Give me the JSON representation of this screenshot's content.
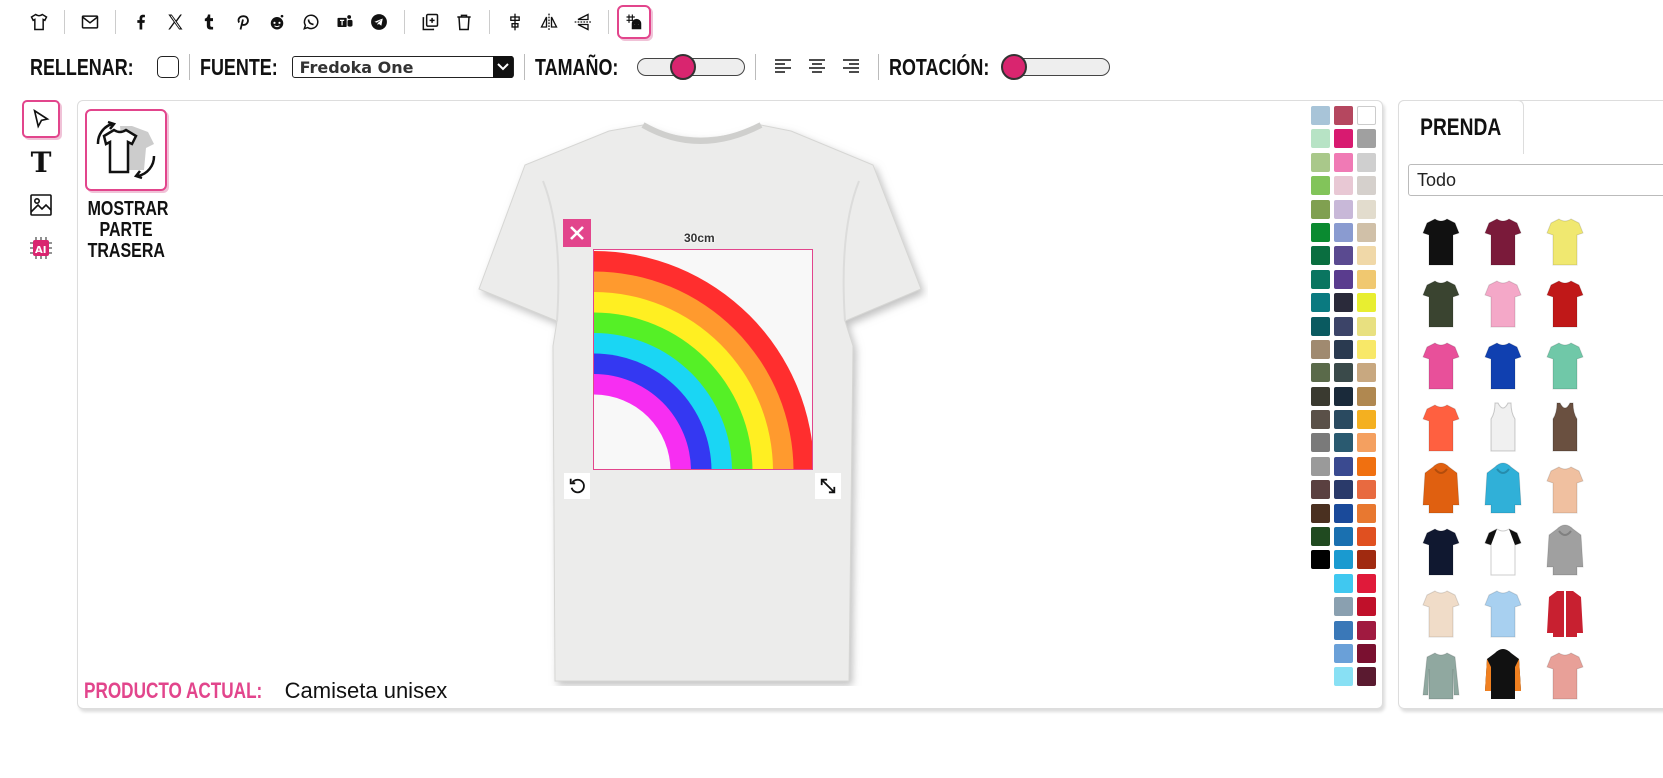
{
  "toolbar": {
    "icons": [
      "tshirt-icon",
      "email-icon",
      "facebook-icon",
      "x-icon",
      "tumblr-icon",
      "pinterest-icon",
      "reddit-icon",
      "whatsapp-icon",
      "teams-icon",
      "telegram-icon",
      "duplicate-icon",
      "delete-icon",
      "align-center-icon",
      "flip-horizontal-icon",
      "flip-vertical-icon",
      "grid-snap-icon"
    ]
  },
  "options": {
    "fill_label": "RELLENAR:",
    "font_label": "FUENTE:",
    "font_value": "Fredoka One",
    "size_label": "TAMAÑO:",
    "size_value": 0.38,
    "rotation_label": "ROTACIÓN:",
    "rotation_value": 0.0
  },
  "left_tools": [
    "select-tool-icon",
    "text-tool-icon",
    "image-tool-icon",
    "ai-tool-icon"
  ],
  "canvas": {
    "back_button_label_1": "MOSTRAR",
    "back_button_label_2": "PARTE",
    "back_button_label_3": "TRASERA",
    "dimension": "30cm",
    "product_label": "PRODUCTO ACTUAL:",
    "product_name": "Camiseta unisex",
    "rainbow_colors": [
      "#ff2e2e",
      "#ff9a2e",
      "#ffef22",
      "#55f026",
      "#1ad6f4",
      "#3438f2",
      "#f72ef2"
    ]
  },
  "palette": [
    [
      "#a8c4d8",
      "#b5475f",
      "#ffffff"
    ],
    [
      "#b7e3c5",
      "#d81a70",
      "#a0a0a0"
    ],
    [
      "#a9c88a",
      "#f07ab5",
      "#cfcfcf"
    ],
    [
      "#82c45a",
      "#e8c8d4",
      "#d5d0cc"
    ],
    [
      "#80a050",
      "#c8b8d8",
      "#e2dccd"
    ],
    [
      "#0a8a30",
      "#8a9bd0",
      "#d0c0a8"
    ],
    [
      "#0a6e40",
      "#5a4a90",
      "#f0d8a8"
    ],
    [
      "#0a7560",
      "#5a3c8e",
      "#f0c870"
    ],
    [
      "#0a7a80",
      "#2a2a3a",
      "#e8ee30"
    ],
    [
      "#0a5a60",
      "#3c4468",
      "#e8e080"
    ],
    [
      "#a08a70",
      "#2a3a50",
      "#f8e868"
    ],
    [
      "#5a6a4a",
      "#3a4a4a",
      "#c8a880"
    ],
    [
      "#3a3a30",
      "#1a2a3a",
      "#b08850"
    ],
    [
      "#5a5048",
      "#2a4a60",
      "#f4b020"
    ],
    [
      "#7a7a7a",
      "#2a5a70",
      "#f4a060"
    ],
    [
      "#9a9a9a",
      "#3a4a90",
      "#f07010"
    ],
    [
      "#5a4040",
      "#2a3a6a",
      "#e86a40"
    ],
    [
      "#4a3020",
      "#1a4a9a",
      "#e87830"
    ],
    [
      "#204a20",
      "#1a70b0",
      "#e05020"
    ],
    [
      "#000000",
      "#1a9ad0",
      "#a02a10"
    ],
    [
      null,
      "#40c8f0",
      "#e01a3a"
    ],
    [
      null,
      "#8aa0b0",
      "#c0102a"
    ],
    [
      null,
      "#3a78b8",
      "#a01a40"
    ],
    [
      null,
      "#6aa0d8",
      "#7a1030"
    ],
    [
      null,
      "#88e0f4",
      "#5a1a30"
    ]
  ],
  "panel": {
    "tab_label": "PRENDA",
    "filter_value": "Todo",
    "products": [
      {
        "name": "black-tshirt",
        "color": "#111111",
        "type": "tee"
      },
      {
        "name": "burgundy-tshirt",
        "color": "#7a1a3a",
        "type": "tee"
      },
      {
        "name": "yellow-tshirt",
        "color": "#f0e870",
        "type": "tee"
      },
      {
        "name": "olive-tshirt",
        "color": "#3a4430",
        "type": "tee"
      },
      {
        "name": "pink-tshirt",
        "color": "#f4a8c8",
        "type": "tee"
      },
      {
        "name": "red-tshirt",
        "color": "#c01818",
        "type": "tee"
      },
      {
        "name": "magenta-tshirt",
        "color": "#e8509a",
        "type": "tee"
      },
      {
        "name": "blue-tshirt",
        "color": "#1040b0",
        "type": "tee"
      },
      {
        "name": "mint-tshirt",
        "color": "#70c8a8",
        "type": "tee"
      },
      {
        "name": "coral-tshirt",
        "color": "#ff6040",
        "type": "tee"
      },
      {
        "name": "white-tank",
        "color": "#f0f0f0",
        "type": "tank"
      },
      {
        "name": "brown-tank",
        "color": "#6a5040",
        "type": "tank"
      },
      {
        "name": "orange-hoodie",
        "color": "#e06010",
        "type": "hoodie"
      },
      {
        "name": "cyan-hoodie",
        "color": "#30b0d8",
        "type": "hoodie"
      },
      {
        "name": "tiedye-tshirt",
        "color": "#f0c0a0",
        "type": "tee"
      },
      {
        "name": "navy-tshirt",
        "color": "#101830",
        "type": "tee"
      },
      {
        "name": "raglan-tshirt",
        "color": "#ffffff",
        "type": "raglan"
      },
      {
        "name": "grey-hoodie",
        "color": "#a0a0a0",
        "type": "hoodie"
      },
      {
        "name": "cream-tshirt",
        "color": "#f0dcc8",
        "type": "tee"
      },
      {
        "name": "skyblue-tshirt",
        "color": "#a8d0f0",
        "type": "tee"
      },
      {
        "name": "red-jacket",
        "color": "#c82030",
        "type": "jacket"
      },
      {
        "name": "sage-longsleeve",
        "color": "#90a8a0",
        "type": "long"
      },
      {
        "name": "black-orange-hoodie",
        "color": "#111111",
        "type": "hoodie2"
      },
      {
        "name": "salmon-tshirt",
        "color": "#e8a098",
        "type": "tee"
      }
    ]
  }
}
